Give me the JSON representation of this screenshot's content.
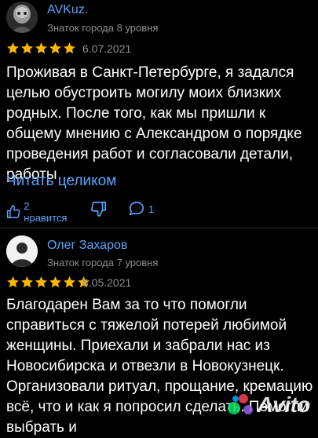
{
  "reviews": [
    {
      "author": "AVKuz.",
      "level": "Знаток города 8 уровня",
      "rating": 5,
      "date": "6.07.2021",
      "text": "Проживая в Санкт-Петербурге, я задался целью обустроить могилу моих близких родных. После того, как мы пришли к общему мнению с Александром о порядке проведения работ и согласовали детали, работы…",
      "read_more": "Читать целиком",
      "likes_label": "2 нравится",
      "comments_count": "1"
    },
    {
      "author": "Олег Захаров",
      "level": "Знаток города 7 уровня",
      "rating": 5,
      "date": "8.05.2021",
      "text": "Благодарен Вам за то что помогли справиться с тяжелой потерей любимой женщины. Приехали и забрали нас из Новосибирска и отвезли в Новокузнецк. Организовали ритуал, прощание, кремацию всё, что и как я попросил сделать. Помогли выбрать и"
    }
  ],
  "watermark": "Avito",
  "colors": {
    "accent": "#5aa6ff",
    "star": "#ffb800",
    "secondary": "#8e8e93",
    "background": "#000000"
  }
}
